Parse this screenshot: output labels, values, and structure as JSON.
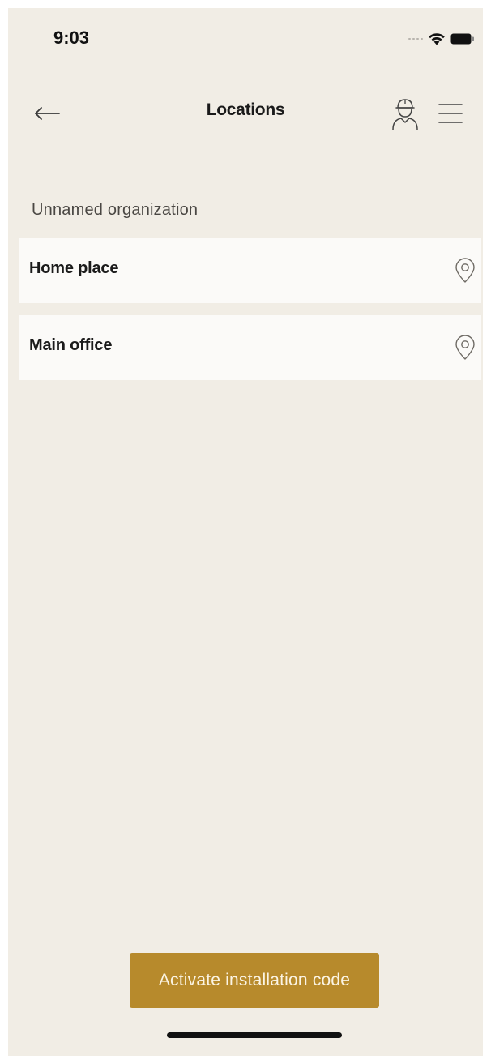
{
  "status_bar": {
    "time": "9:03",
    "icons": [
      "cellular-signal-icon",
      "wifi-icon",
      "battery-icon"
    ]
  },
  "header": {
    "back_icon": "arrow-left-icon",
    "title": "Locations",
    "installer_icon": "installer-person-icon",
    "menu_icon": "hamburger-menu-icon"
  },
  "organization": {
    "name": "Unnamed organization"
  },
  "locations": [
    {
      "name": "Home place",
      "icon": "location-pin-icon"
    },
    {
      "name": "Main office",
      "icon": "location-pin-icon"
    }
  ],
  "actions": {
    "activate_label": "Activate installation code"
  },
  "colors": {
    "background": "#f1ede5",
    "card": "#fbfaf8",
    "accent": "#b78a2c",
    "accent_text": "#fbf4e4",
    "text_primary": "#1b1b1b",
    "text_secondary": "#4a4743"
  }
}
